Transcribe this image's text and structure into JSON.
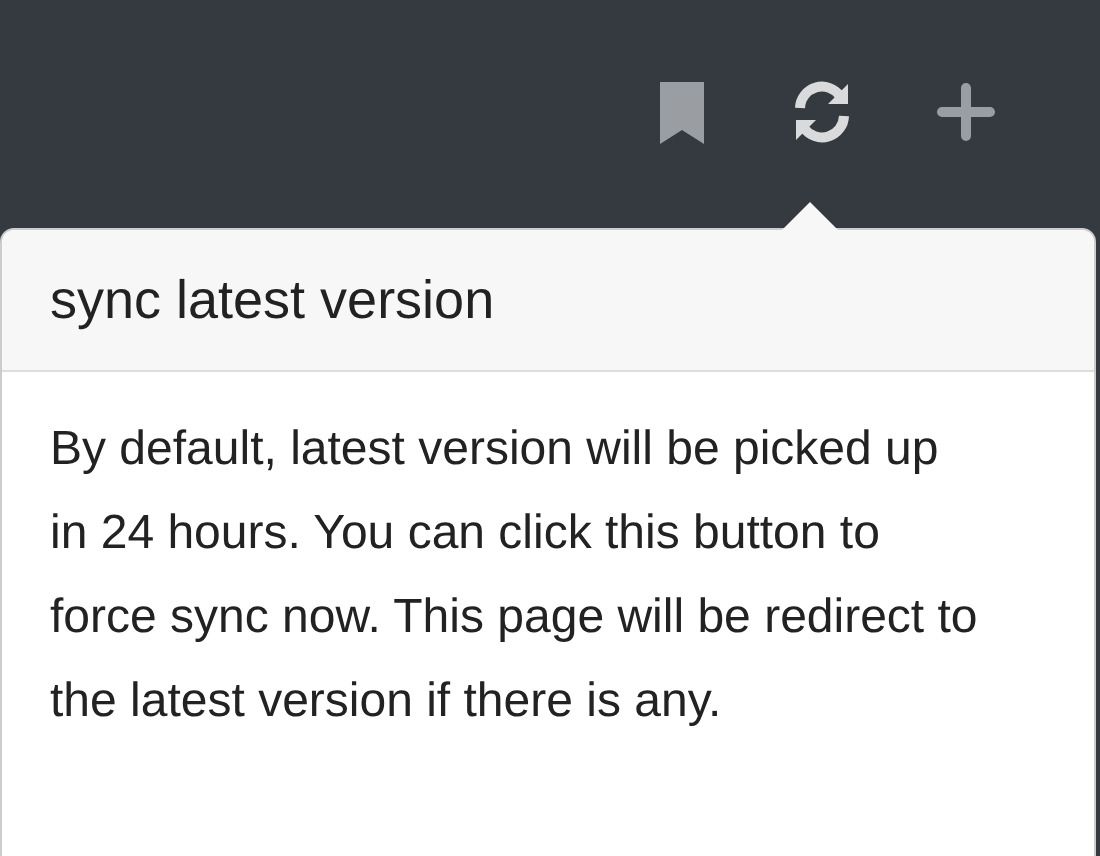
{
  "toolbar": {
    "icons": [
      {
        "kind": "bookmark",
        "selected": false
      },
      {
        "kind": "sync",
        "selected": true
      },
      {
        "kind": "plus",
        "selected": false
      }
    ]
  },
  "popover": {
    "title": "sync latest version",
    "body": "By default, latest version will be picked up in 24 hours. You can click this button to force sync now. This page will be redirect to the latest version if there is any."
  }
}
